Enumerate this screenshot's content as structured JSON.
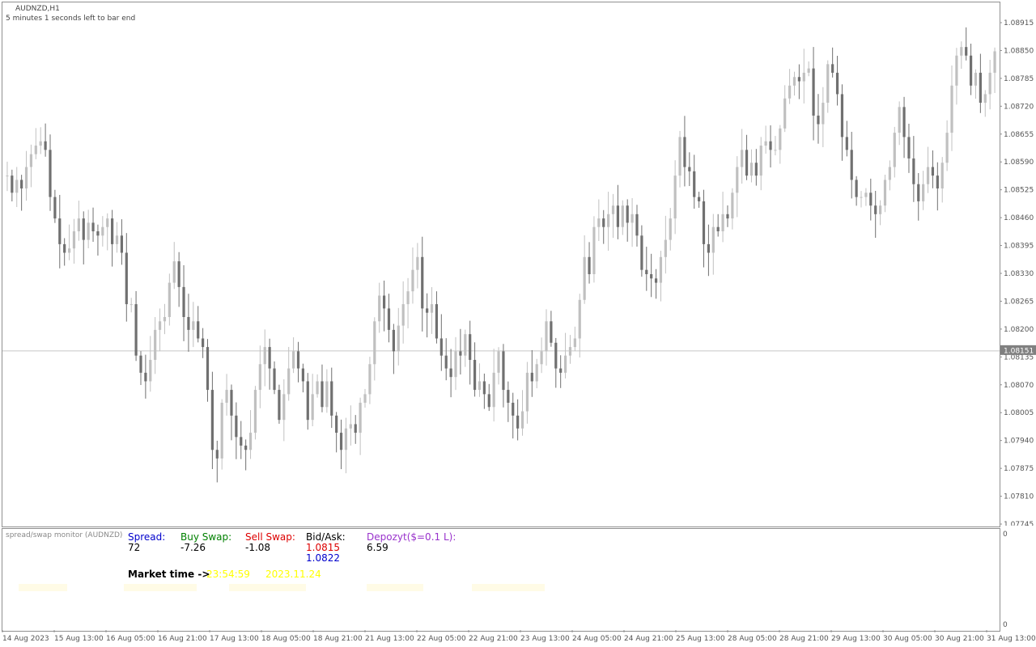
{
  "chart_title": "AUDNZD,H1",
  "bar_timer": "5 minutes 1 seconds left to bar end",
  "price_marker": "1.08151",
  "price_marker_value": 1.08151,
  "indicator": {
    "name": "spread/swap monitor (AUDNZD)",
    "spread_label": "Spread:",
    "spread_value": "72",
    "buy_swap_label": "Buy Swap:",
    "buy_swap_value": "-7.26",
    "sell_swap_label": "Sell Swap:",
    "sell_swap_value": "-1.08",
    "bidask_label": "Bid/Ask:",
    "bid_value": "1.0815",
    "ask_value": "1.0822",
    "depozyt_label": "Depozyt($=0.1 L):",
    "depozyt_value": "6.59",
    "market_time_label": "Market time ->",
    "market_time_value": "23:54:59",
    "market_date_value": "2023.11.24",
    "colors": {
      "spread": "#0000cc",
      "buy": "#008000",
      "sell": "#dd0000",
      "bid": "#dd0000",
      "ask": "#0000cc",
      "depozyt": "#9932cc",
      "market": "#ffff00"
    },
    "sub_axis_top": "0",
    "sub_axis_bottom": "0"
  },
  "time_labels": [
    "14 Aug 2023",
    "15 Aug 13:00",
    "16 Aug 05:00",
    "16 Aug 21:00",
    "17 Aug 13:00",
    "18 Aug 05:00",
    "18 Aug 21:00",
    "21 Aug 13:00",
    "22 Aug 05:00",
    "22 Aug 21:00",
    "23 Aug 13:00",
    "24 Aug 05:00",
    "24 Aug 21:00",
    "25 Aug 13:00",
    "28 Aug 05:00",
    "28 Aug 21:00",
    "29 Aug 13:00",
    "30 Aug 05:00",
    "30 Aug 21:00",
    "31 Aug 13:00"
  ],
  "chart_data": {
    "type": "candlestick",
    "symbol": "AUDNZD",
    "timeframe": "H1",
    "ylim": [
      1.07745,
      1.08915
    ],
    "y_ticks": [
      "1.08915",
      "1.08850",
      "1.08785",
      "1.08720",
      "1.08655",
      "1.08590",
      "1.08525",
      "1.08460",
      "1.08395",
      "1.08330",
      "1.08265",
      "1.08200",
      "1.08135",
      "1.08070",
      "1.08005",
      "1.07940",
      "1.07875",
      "1.07810",
      "1.07745"
    ],
    "up_color": "#c0c0c0",
    "down_color": "#707070",
    "closes": [
      1.0856,
      1.0852,
      1.0855,
      1.0853,
      1.0858,
      1.0861,
      1.0863,
      1.0864,
      1.0862,
      1.0851,
      1.0846,
      1.084,
      1.0838,
      1.0839,
      1.0843,
      1.0846,
      1.0841,
      1.0845,
      1.0843,
      1.0842,
      1.0844,
      1.0846,
      1.084,
      1.0842,
      1.0838,
      1.0826,
      1.0826,
      1.0814,
      1.081,
      1.0808,
      1.0813,
      1.082,
      1.0822,
      1.0823,
      1.0831,
      1.0836,
      1.083,
      1.0823,
      1.082,
      1.0822,
      1.0818,
      1.0816,
      1.0806,
      1.0792,
      1.079,
      1.0803,
      1.0806,
      1.08,
      1.0795,
      1.0793,
      1.0792,
      1.0796,
      1.0806,
      1.0812,
      1.0816,
      1.0811,
      1.0806,
      1.0799,
      1.0805,
      1.0811,
      1.0815,
      1.0811,
      1.0808,
      1.0799,
      1.0805,
      1.0808,
      1.0802,
      1.0808,
      1.08,
      1.0796,
      1.0792,
      1.0797,
      1.0798,
      1.0796,
      1.0803,
      1.0805,
      1.0812,
      1.0822,
      1.0828,
      1.0825,
      1.082,
      1.0815,
      1.0821,
      1.0826,
      1.0829,
      1.0834,
      1.0837,
      1.0825,
      1.0824,
      1.0826,
      1.0818,
      1.0814,
      1.0811,
      1.0809,
      1.0815,
      1.0814,
      1.0819,
      1.0813,
      1.0806,
      1.0808,
      1.0805,
      1.0802,
      1.081,
      1.0815,
      1.0806,
      1.0803,
      1.08,
      1.0797,
      1.0801,
      1.081,
      1.0808,
      1.0812,
      1.0815,
      1.0822,
      1.0817,
      1.0811,
      1.081,
      1.0814,
      1.0816,
      1.0818,
      1.0827,
      1.0837,
      1.0833,
      1.0844,
      1.0846,
      1.0844,
      1.0847,
      1.0849,
      1.0844,
      1.0849,
      1.0845,
      1.0847,
      1.0842,
      1.0834,
      1.0833,
      1.0832,
      1.0831,
      1.0837,
      1.0841,
      1.0846,
      1.0856,
      1.0865,
      1.0858,
      1.0857,
      1.0851,
      1.085,
      1.084,
      1.0838,
      1.0844,
      1.0843,
      1.0847,
      1.0846,
      1.0852,
      1.0858,
      1.0862,
      1.0856,
      1.0859,
      1.0856,
      1.0863,
      1.0864,
      1.0862,
      1.0862,
      1.0867,
      1.0874,
      1.0877,
      1.0879,
      1.0878,
      1.088,
      1.0881,
      1.087,
      1.0868,
      1.0873,
      1.0882,
      1.088,
      1.0875,
      1.0865,
      1.0862,
      1.0855,
      1.0851,
      1.0851,
      1.0852,
      1.0849,
      1.0847,
      1.0849,
      1.0855,
      1.0858,
      1.0866,
      1.0872,
      1.0865,
      1.086,
      1.0854,
      1.085,
      1.0854,
      1.0858,
      1.0856,
      1.0853,
      1.0859,
      1.0866,
      1.0877,
      1.0884,
      1.0886,
      1.0884,
      1.0877,
      1.088,
      1.0873,
      1.0875,
      1.088,
      1.0885
    ]
  }
}
